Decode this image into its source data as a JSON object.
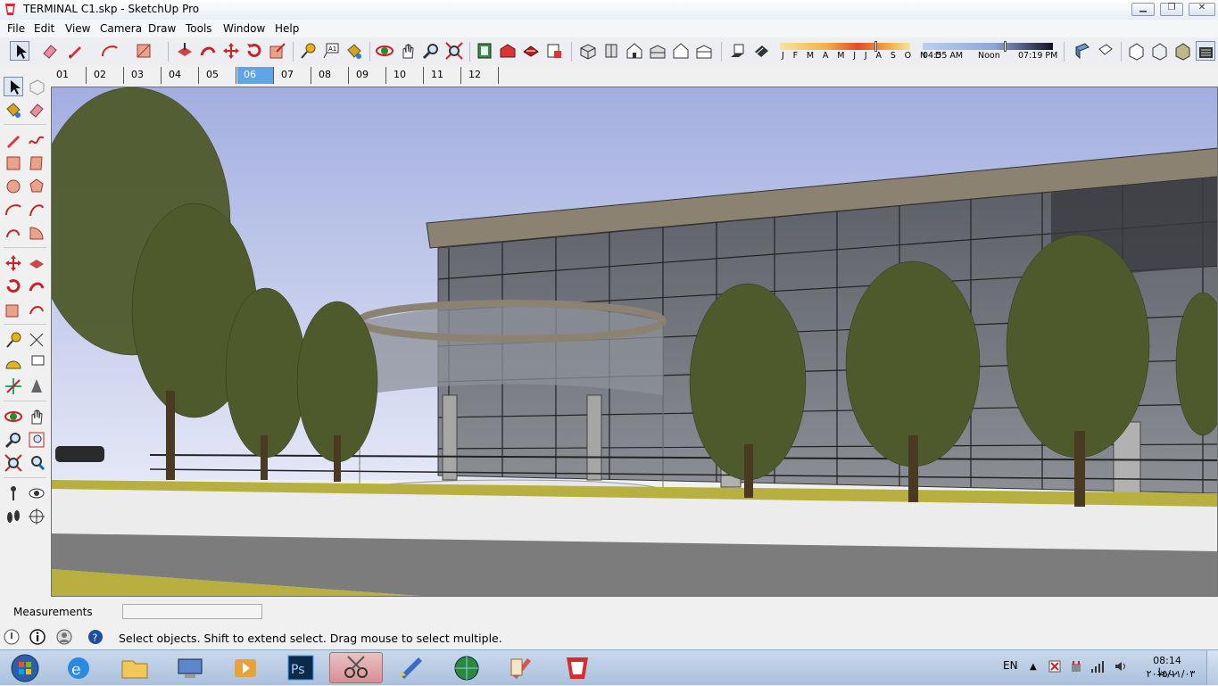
{
  "window": {
    "title": "TERMINAL C1.skp - SketchUp Pro",
    "app_icon": "sketchup-logo-icon",
    "minimize_icon": "minimize-icon",
    "maximize_icon": "restore-icon",
    "close_icon": "close-icon"
  },
  "menubar": {
    "items": [
      "File",
      "Edit",
      "View",
      "Camera",
      "Draw",
      "Tools",
      "Window",
      "Help"
    ]
  },
  "toolbar": {
    "months_label": "J F M A M J J A S O N D",
    "time_start": "04:55 AM",
    "time_noon": "Noon",
    "time_end": "07:19 PM",
    "month_position": 0.73,
    "time_position": 0.63
  },
  "scenes": {
    "tabs": [
      "01",
      "02",
      "03",
      "04",
      "05",
      "06",
      "07",
      "08",
      "09",
      "10",
      "11",
      "12"
    ],
    "active_tab": "06"
  },
  "measurements": {
    "label": "Measurements",
    "value": ""
  },
  "status": {
    "text": "Select objects. Shift to extend select. Drag mouse to select multiple."
  },
  "taskbar": {
    "language": "EN",
    "clock_time": "08:14 ب.ظ",
    "clock_date": "۲۰۱۵/۱۱/۰۳",
    "apps": [
      "start-orb",
      "internet-explorer",
      "file-explorer",
      "remote-desktop",
      "media-player",
      "photoshop",
      "snipping-tool",
      "paint-brush-app",
      "globe-app",
      "drawing-app",
      "sketchup"
    ],
    "active_app": "snipping-tool"
  },
  "colors": {
    "scene_active": "#5fa3e8",
    "sky_top": "#a9b3dc",
    "sky_bottom": "#dfe4f6",
    "grass": "#b7b040",
    "ground": "#ececec"
  }
}
